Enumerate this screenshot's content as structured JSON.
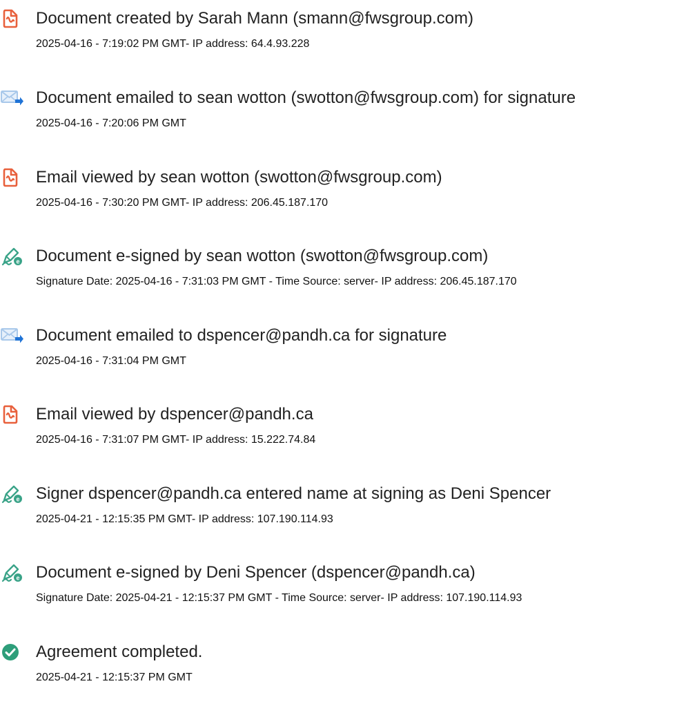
{
  "events": [
    {
      "icon": "document-icon",
      "title": "Document created by Sarah Mann (smann@fwsgroup.com)",
      "detail": "2025-04-16 - 7:19:02 PM GMT- IP address: 64.4.93.228"
    },
    {
      "icon": "email-icon",
      "title": "Document emailed to sean wotton (swotton@fwsgroup.com) for signature",
      "detail": "2025-04-16 - 7:20:06 PM GMT"
    },
    {
      "icon": "document-icon",
      "title": "Email viewed by sean wotton (swotton@fwsgroup.com)",
      "detail": "2025-04-16 - 7:30:20 PM GMT- IP address: 206.45.187.170"
    },
    {
      "icon": "esign-pen-icon",
      "title": "Document e-signed by sean wotton (swotton@fwsgroup.com)",
      "detail": "Signature Date: 2025-04-16 - 7:31:03 PM GMT - Time Source: server- IP address: 206.45.187.170"
    },
    {
      "icon": "email-icon",
      "title": "Document emailed to dspencer@pandh.ca for signature",
      "detail": "2025-04-16 - 7:31:04 PM GMT"
    },
    {
      "icon": "document-icon",
      "title": "Email viewed by dspencer@pandh.ca",
      "detail": "2025-04-16 - 7:31:07 PM GMT- IP address: 15.222.74.84"
    },
    {
      "icon": "esign-pen-icon",
      "title": "Signer dspencer@pandh.ca entered name at signing as Deni Spencer",
      "detail": "2025-04-21 - 12:15:35 PM GMT- IP address: 107.190.114.93"
    },
    {
      "icon": "esign-pen-icon",
      "title": "Document e-signed by Deni Spencer (dspencer@pandh.ca)",
      "detail": "Signature Date: 2025-04-21 - 12:15:37 PM GMT - Time Source: server- IP address: 107.190.114.93"
    },
    {
      "icon": "check-circle-icon",
      "title": "Agreement completed.",
      "detail": "2025-04-21 - 12:15:37 PM GMT"
    }
  ],
  "colors": {
    "document_icon": "#e8603c",
    "email_icon_envelope": "#a8c8ea",
    "email_icon_arrow": "#1f73d6",
    "pen_icon": "#3aa388",
    "check_icon": "#2e9e7a",
    "title_text": "#222222",
    "detail_text": "#111111"
  }
}
